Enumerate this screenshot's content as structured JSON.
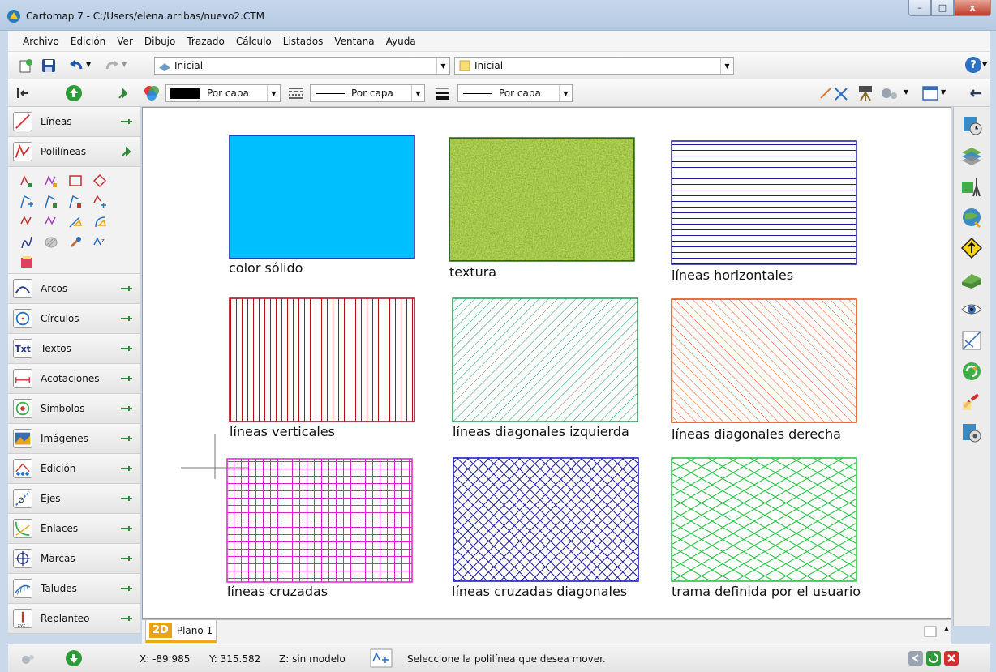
{
  "window": {
    "title": "Cartomap 7 - C:/Users/elena.arribas/nuevo2.CTM",
    "min": "–",
    "max": "□",
    "close": "x"
  },
  "menu": [
    "Archivo",
    "Edición",
    "Ver",
    "Dibujo",
    "Trazado",
    "Cálculo",
    "Listados",
    "Ventana",
    "Ayuda"
  ],
  "toolbar": {
    "view_combo": "Inicial",
    "layer_combo": "Inicial",
    "color_combo": "Por capa",
    "linetype_combo": "Por capa",
    "lineweight_combo": "Por capa",
    "help_icon": "?"
  },
  "left_panel": {
    "items": [
      "Líneas",
      "Polilíneas",
      "Arcos",
      "Círculos",
      "Textos",
      "Acotaciones",
      "Símbolos",
      "Imágenes",
      "Edición",
      "Ejes",
      "Enlaces",
      "Marcas",
      "Taludes",
      "Replanteo"
    ],
    "textos_icon_label": "Txt"
  },
  "canvas": {
    "swatches": [
      {
        "label": "color sólido",
        "color": "#00bfff",
        "border": "#1a1aa0"
      },
      {
        "label": "textura",
        "color": "#4a5a1a",
        "border": "#2c6b1c"
      },
      {
        "label": "líneas horizontales",
        "color": "#1a1aa0",
        "border": "#1a1aa0"
      },
      {
        "label": "líneas verticales",
        "color": "#b01020",
        "border": "#a00018"
      },
      {
        "label": "líneas diagonales izquierda",
        "color": "#1a9a50",
        "border": "#1a9a50"
      },
      {
        "label": "líneas diagonales derecha",
        "color": "#f05010",
        "border": "#e04000"
      },
      {
        "label": "líneas cruzadas",
        "color": "#e020d0",
        "border": "#e020d0"
      },
      {
        "label": "líneas cruzadas diagonales",
        "color": "#1a1aa0",
        "border": "#1010c0"
      },
      {
        "label": "trama definida por el usuario",
        "color": "#20c040",
        "border": "#20c040"
      }
    ]
  },
  "tabs": {
    "mode": "2D",
    "plan": "Plano 1"
  },
  "status": {
    "x": "X:  -89.985",
    "y": "Y:  315.582",
    "z": "Z:  sin modelo",
    "message": "Seleccione la polilínea que desea mover."
  }
}
